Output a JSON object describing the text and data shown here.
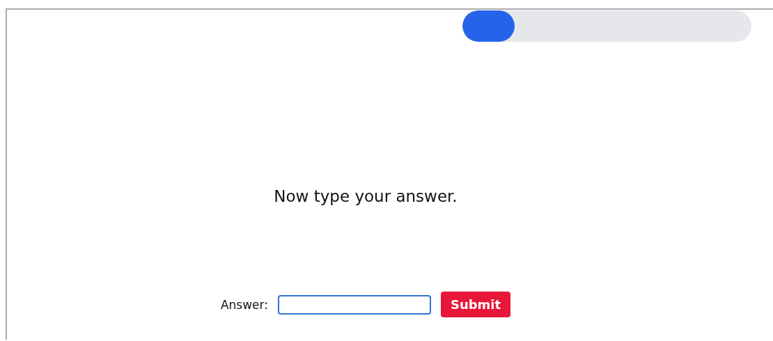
{
  "progress": {
    "level": 0.18
  },
  "prompt": "Now type your answer.",
  "answer": {
    "label": "Answer:"
  },
  "submit": "Submit"
}
